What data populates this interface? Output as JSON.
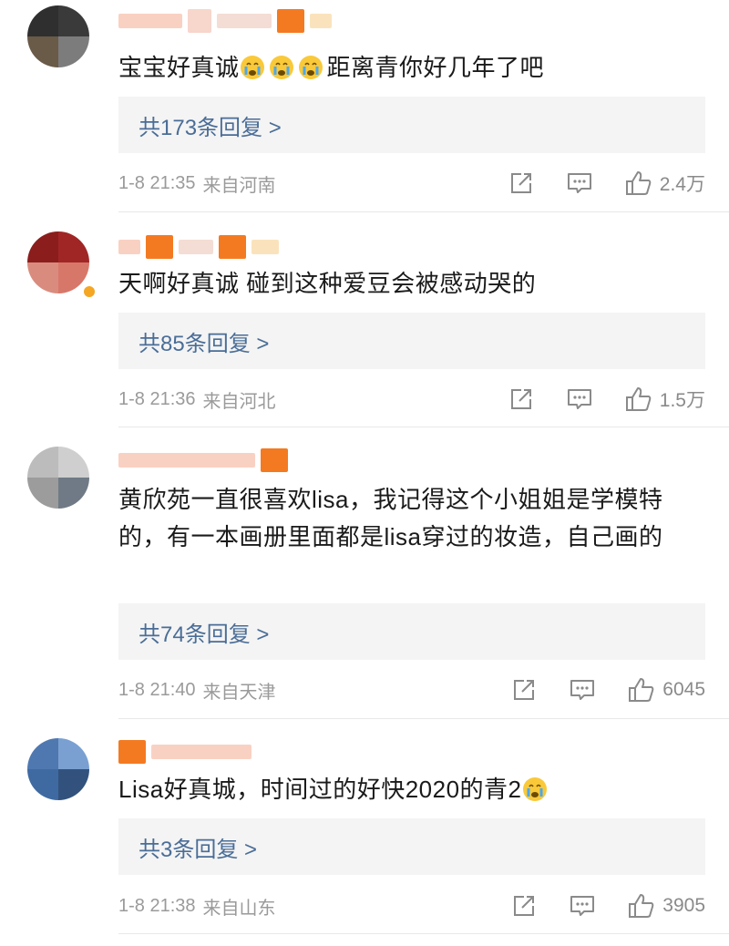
{
  "comments": [
    {
      "text_before": "宝宝好真诚",
      "emoji_count": 3,
      "text_after": "距离青你好几年了吧",
      "reply_label": "共173条回复 >",
      "time": "1-8 21:35",
      "location": "来自河南",
      "likes": "2.4万",
      "avatar_colors": [
        "#2f2f2f",
        "#3a3a3a",
        "#6a5a48",
        "#7c7c7c"
      ]
    },
    {
      "text_before": "天啊好真诚  碰到这种爱豆会被感动哭的",
      "reply_label": "共85条回复 >",
      "time": "1-8 21:36",
      "location": "来自河北",
      "likes": "1.5万",
      "avatar_colors": [
        "#8c1d1d",
        "#a02626",
        "#d98c7e",
        "#d7776a"
      ]
    },
    {
      "text_before": "黄欣苑一直很喜欢lisa，我记得这个小姐姐是学模特的，有一本画册里面都是lisa穿过的妆造，自己画的",
      "reply_label": "共74条回复 >",
      "time": "1-8 21:40",
      "location": "来自天津",
      "likes": "6045",
      "avatar_colors": [
        "#bcbcbc",
        "#cfcfcf",
        "#9c9c9c",
        "#6f7a86"
      ]
    },
    {
      "text_before": "Lisa好真城，时间过的好快2020的青2",
      "emoji_count": 1,
      "text_after": "",
      "reply_label": "共3条回复 >",
      "time": "1-8 21:38",
      "location": "来自山东",
      "likes": "3905",
      "avatar_colors": [
        "#4f78b0",
        "#7aa0d2",
        "#3f6aa1",
        "#32527d"
      ]
    }
  ]
}
